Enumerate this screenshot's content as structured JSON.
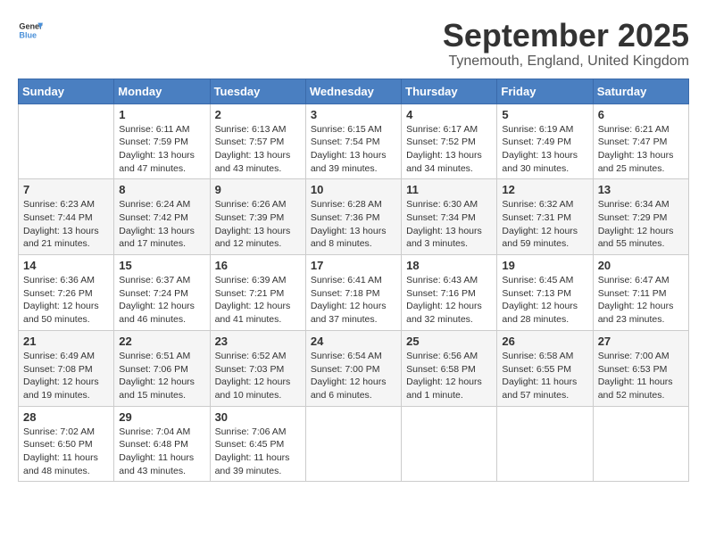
{
  "logo": {
    "general": "General",
    "blue": "Blue"
  },
  "title": "September 2025",
  "subtitle": "Tynemouth, England, United Kingdom",
  "days_of_week": [
    "Sunday",
    "Monday",
    "Tuesday",
    "Wednesday",
    "Thursday",
    "Friday",
    "Saturday"
  ],
  "weeks": [
    [
      {
        "day": "",
        "info": ""
      },
      {
        "day": "1",
        "info": "Sunrise: 6:11 AM\nSunset: 7:59 PM\nDaylight: 13 hours\nand 47 minutes."
      },
      {
        "day": "2",
        "info": "Sunrise: 6:13 AM\nSunset: 7:57 PM\nDaylight: 13 hours\nand 43 minutes."
      },
      {
        "day": "3",
        "info": "Sunrise: 6:15 AM\nSunset: 7:54 PM\nDaylight: 13 hours\nand 39 minutes."
      },
      {
        "day": "4",
        "info": "Sunrise: 6:17 AM\nSunset: 7:52 PM\nDaylight: 13 hours\nand 34 minutes."
      },
      {
        "day": "5",
        "info": "Sunrise: 6:19 AM\nSunset: 7:49 PM\nDaylight: 13 hours\nand 30 minutes."
      },
      {
        "day": "6",
        "info": "Sunrise: 6:21 AM\nSunset: 7:47 PM\nDaylight: 13 hours\nand 25 minutes."
      }
    ],
    [
      {
        "day": "7",
        "info": "Sunrise: 6:23 AM\nSunset: 7:44 PM\nDaylight: 13 hours\nand 21 minutes."
      },
      {
        "day": "8",
        "info": "Sunrise: 6:24 AM\nSunset: 7:42 PM\nDaylight: 13 hours\nand 17 minutes."
      },
      {
        "day": "9",
        "info": "Sunrise: 6:26 AM\nSunset: 7:39 PM\nDaylight: 13 hours\nand 12 minutes."
      },
      {
        "day": "10",
        "info": "Sunrise: 6:28 AM\nSunset: 7:36 PM\nDaylight: 13 hours\nand 8 minutes."
      },
      {
        "day": "11",
        "info": "Sunrise: 6:30 AM\nSunset: 7:34 PM\nDaylight: 13 hours\nand 3 minutes."
      },
      {
        "day": "12",
        "info": "Sunrise: 6:32 AM\nSunset: 7:31 PM\nDaylight: 12 hours\nand 59 minutes."
      },
      {
        "day": "13",
        "info": "Sunrise: 6:34 AM\nSunset: 7:29 PM\nDaylight: 12 hours\nand 55 minutes."
      }
    ],
    [
      {
        "day": "14",
        "info": "Sunrise: 6:36 AM\nSunset: 7:26 PM\nDaylight: 12 hours\nand 50 minutes."
      },
      {
        "day": "15",
        "info": "Sunrise: 6:37 AM\nSunset: 7:24 PM\nDaylight: 12 hours\nand 46 minutes."
      },
      {
        "day": "16",
        "info": "Sunrise: 6:39 AM\nSunset: 7:21 PM\nDaylight: 12 hours\nand 41 minutes."
      },
      {
        "day": "17",
        "info": "Sunrise: 6:41 AM\nSunset: 7:18 PM\nDaylight: 12 hours\nand 37 minutes."
      },
      {
        "day": "18",
        "info": "Sunrise: 6:43 AM\nSunset: 7:16 PM\nDaylight: 12 hours\nand 32 minutes."
      },
      {
        "day": "19",
        "info": "Sunrise: 6:45 AM\nSunset: 7:13 PM\nDaylight: 12 hours\nand 28 minutes."
      },
      {
        "day": "20",
        "info": "Sunrise: 6:47 AM\nSunset: 7:11 PM\nDaylight: 12 hours\nand 23 minutes."
      }
    ],
    [
      {
        "day": "21",
        "info": "Sunrise: 6:49 AM\nSunset: 7:08 PM\nDaylight: 12 hours\nand 19 minutes."
      },
      {
        "day": "22",
        "info": "Sunrise: 6:51 AM\nSunset: 7:06 PM\nDaylight: 12 hours\nand 15 minutes."
      },
      {
        "day": "23",
        "info": "Sunrise: 6:52 AM\nSunset: 7:03 PM\nDaylight: 12 hours\nand 10 minutes."
      },
      {
        "day": "24",
        "info": "Sunrise: 6:54 AM\nSunset: 7:00 PM\nDaylight: 12 hours\nand 6 minutes."
      },
      {
        "day": "25",
        "info": "Sunrise: 6:56 AM\nSunset: 6:58 PM\nDaylight: 12 hours\nand 1 minute."
      },
      {
        "day": "26",
        "info": "Sunrise: 6:58 AM\nSunset: 6:55 PM\nDaylight: 11 hours\nand 57 minutes."
      },
      {
        "day": "27",
        "info": "Sunrise: 7:00 AM\nSunset: 6:53 PM\nDaylight: 11 hours\nand 52 minutes."
      }
    ],
    [
      {
        "day": "28",
        "info": "Sunrise: 7:02 AM\nSunset: 6:50 PM\nDaylight: 11 hours\nand 48 minutes."
      },
      {
        "day": "29",
        "info": "Sunrise: 7:04 AM\nSunset: 6:48 PM\nDaylight: 11 hours\nand 43 minutes."
      },
      {
        "day": "30",
        "info": "Sunrise: 7:06 AM\nSunset: 6:45 PM\nDaylight: 11 hours\nand 39 minutes."
      },
      {
        "day": "",
        "info": ""
      },
      {
        "day": "",
        "info": ""
      },
      {
        "day": "",
        "info": ""
      },
      {
        "day": "",
        "info": ""
      }
    ]
  ]
}
